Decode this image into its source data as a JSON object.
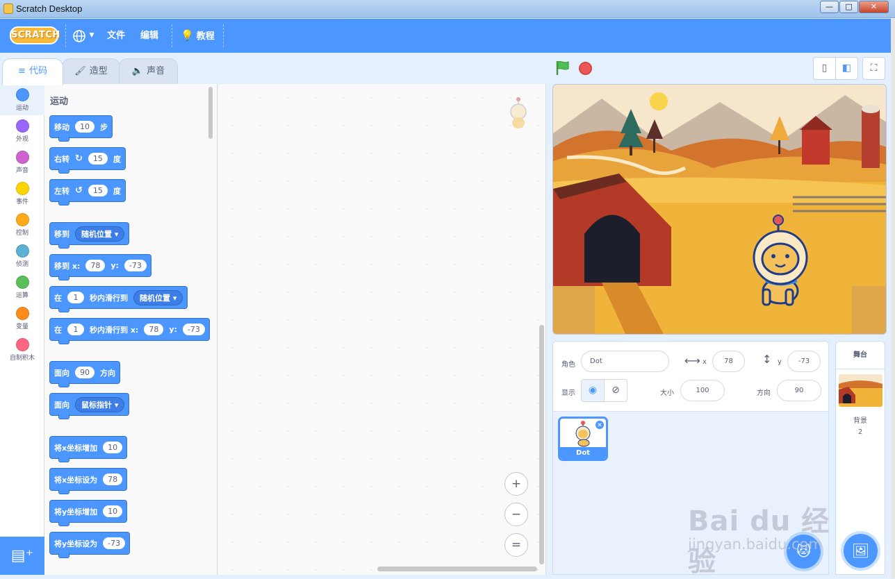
{
  "window": {
    "title": "Scratch Desktop",
    "minimize": "—",
    "maximize": "□",
    "close": "✕"
  },
  "menubar": {
    "logo": "SCRATCH",
    "language_icon": "globe-icon",
    "file": "文件",
    "edit": "编辑",
    "tutorials": "教程"
  },
  "tabs": [
    {
      "label": "代码",
      "icon": "code-icon",
      "active": true
    },
    {
      "label": "造型",
      "icon": "brush-icon",
      "active": false
    },
    {
      "label": "声音",
      "icon": "speaker-icon",
      "active": false
    }
  ],
  "categories": [
    {
      "label": "运动",
      "color": "#4c97ff"
    },
    {
      "label": "外观",
      "color": "#9966ff"
    },
    {
      "label": "声音",
      "color": "#cf63cf"
    },
    {
      "label": "事件",
      "color": "#ffd500"
    },
    {
      "label": "控制",
      "color": "#ffab19"
    },
    {
      "label": "侦测",
      "color": "#5cb1d6"
    },
    {
      "label": "运算",
      "color": "#59c059"
    },
    {
      "label": "变量",
      "color": "#ff8c1a"
    },
    {
      "label": "自制积木",
      "color": "#ff6680"
    }
  ],
  "palette": {
    "title": "运动",
    "blocks": {
      "move": {
        "a": "移动",
        "v": "10",
        "b": "步"
      },
      "turn_right": {
        "a": "右转",
        "v": "15",
        "b": "度"
      },
      "turn_left": {
        "a": "左转",
        "v": "15",
        "b": "度"
      },
      "goto": {
        "a": "移到",
        "d": "随机位置"
      },
      "goto_xy": {
        "a": "移到 x:",
        "x": "78",
        "b": "y:",
        "y": "-73"
      },
      "glide": {
        "a": "在",
        "v": "1",
        "b": "秒内滑行到",
        "d": "随机位置"
      },
      "glide_xy": {
        "a": "在",
        "v": "1",
        "b": "秒内滑行到 x:",
        "x": "78",
        "c": "y:",
        "y": "-73"
      },
      "point_dir": {
        "a": "面向",
        "v": "90",
        "b": "方向"
      },
      "point_towards": {
        "a": "面向",
        "d": "鼠标指针"
      },
      "change_x": {
        "a": "将x坐标增加",
        "v": "10"
      },
      "set_x": {
        "a": "将x坐标设为",
        "v": "78"
      },
      "change_y": {
        "a": "将y坐标增加",
        "v": "10"
      },
      "set_y": {
        "a": "将y坐标设为",
        "v": "-73"
      }
    }
  },
  "workspace": {
    "zoom_in": "+",
    "zoom_out": "−",
    "zoom_reset": "="
  },
  "sprite_info": {
    "sprite_label": "角色",
    "sprite_name": "Dot",
    "x_label": "x",
    "x": "78",
    "y_label": "y",
    "y": "-73",
    "show_label": "显示",
    "size_label": "大小",
    "size": "100",
    "direction_label": "方向",
    "direction": "90"
  },
  "sprites": [
    {
      "name": "Dot",
      "selected": true
    }
  ],
  "stage_pane": {
    "title": "舞台",
    "backdrops_label": "背景",
    "backdrops_count": "2"
  },
  "watermark": {
    "line1": "Bai du 经验",
    "line2": "jingyan.baidu.com"
  }
}
